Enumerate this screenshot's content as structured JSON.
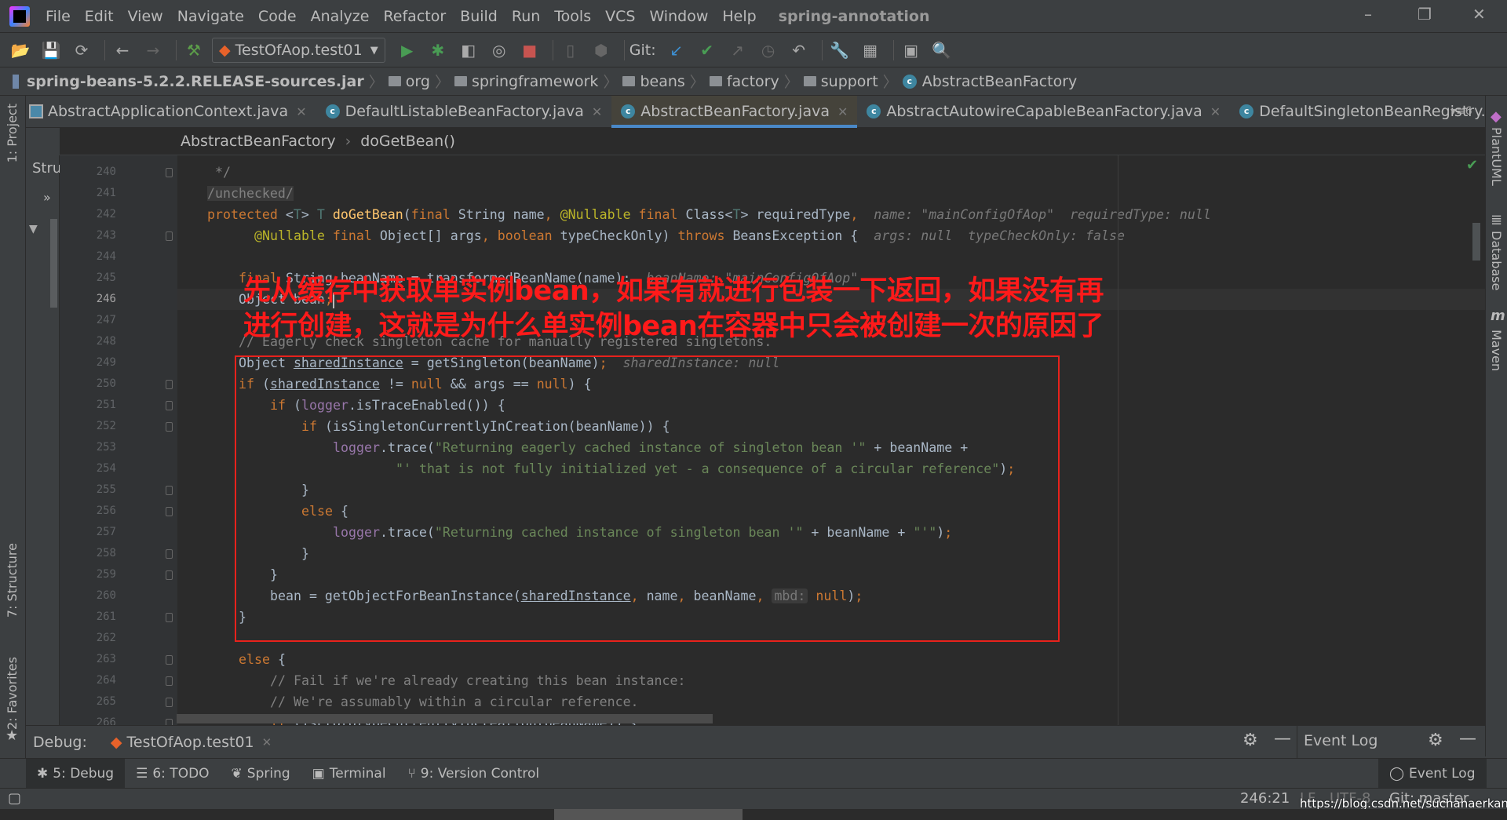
{
  "menubar": {
    "items": [
      "File",
      "Edit",
      "View",
      "Navigate",
      "Code",
      "Analyze",
      "Refactor",
      "Build",
      "Run",
      "Tools",
      "VCS",
      "Window",
      "Help"
    ],
    "project_title": "spring-annotation",
    "window_controls": [
      "–",
      "❐",
      "✕"
    ]
  },
  "toolbar": {
    "run_config": "TestOfAop.test01",
    "git_label": "Git:"
  },
  "navbar": {
    "jar": "spring-beans-5.2.2.RELEASE-sources.jar",
    "folders": [
      "org",
      "springframework",
      "beans",
      "factory",
      "support"
    ],
    "class": "AbstractBeanFactory"
  },
  "tabs": [
    {
      "label": "AbstractApplicationContext.java",
      "active": false
    },
    {
      "label": "DefaultListableBeanFactory.java",
      "active": false
    },
    {
      "label": "AbstractBeanFactory.java",
      "active": true
    },
    {
      "label": "AbstractAutowireCapableBeanFactory.java",
      "active": false
    },
    {
      "label": "DefaultSingletonBeanRegistry.java",
      "active": false
    }
  ],
  "tabs_overflow": "6",
  "editor_breadcrumb": {
    "class": "AbstractBeanFactory",
    "method": "doGetBean()"
  },
  "left_strip": {
    "project": "1: Project",
    "structure": "7: Structure",
    "favorites": "2: Favorites"
  },
  "structure_panel": {
    "label": "Stru",
    "expand": "»"
  },
  "right_strip": [
    "PlantUML",
    "Database",
    "Maven"
  ],
  "current_line": 246,
  "code": [
    {
      "n": 240,
      "i": 1,
      "t": [
        [
          "cm",
          "*/"
        ]
      ]
    },
    {
      "n": 241,
      "i": 0,
      "t": [
        [
          "cm fol",
          "/unchecked/"
        ]
      ]
    },
    {
      "n": 242,
      "i": 0,
      "t": [
        [
          "kw",
          "protected "
        ],
        [
          "",
          "<"
        ],
        [
          "tp",
          "T"
        ],
        [
          "",
          "> "
        ],
        [
          "tp",
          "T "
        ],
        [
          "fn",
          "doGetBean"
        ],
        [
          "",
          "("
        ],
        [
          "kw",
          "final "
        ],
        [
          "",
          "String name"
        ],
        [
          "kw",
          ", "
        ],
        [
          "ann",
          "@Nullable "
        ],
        [
          "kw",
          "final "
        ],
        [
          "",
          "Class<"
        ],
        [
          "tp",
          "T"
        ],
        [
          "",
          "> requiredType"
        ],
        [
          "kw",
          ","
        ],
        [
          "hint",
          "  name: \"mainConfigOfAop\"  requiredType: null"
        ]
      ]
    },
    {
      "n": 243,
      "i": 6,
      "t": [
        [
          "ann",
          "@Nullable "
        ],
        [
          "kw",
          "final "
        ],
        [
          "",
          "Object[] args"
        ],
        [
          "kw",
          ", boolean "
        ],
        [
          "",
          "typeCheckOnly) "
        ],
        [
          "kw",
          "throws "
        ],
        [
          "",
          "BeansException {"
        ],
        [
          "hint",
          "  args: null  typeCheckOnly: false"
        ]
      ]
    },
    {
      "n": 244,
      "i": 0,
      "t": []
    },
    {
      "n": 245,
      "i": 4,
      "t": [
        [
          "kw",
          "final "
        ],
        [
          "",
          "String beanName = transformedBeanName(name);"
        ],
        [
          "hint",
          "  beanName: \"mainConfigOfAop\""
        ]
      ]
    },
    {
      "n": 246,
      "i": 4,
      "t": [
        [
          "",
          "Object bean"
        ],
        [
          "kw",
          ";"
        ]
      ]
    },
    {
      "n": 247,
      "i": 0,
      "t": []
    },
    {
      "n": 248,
      "i": 4,
      "t": [
        [
          "cm",
          "// Eagerly check singleton cache for manually registered singletons."
        ]
      ]
    },
    {
      "n": 249,
      "i": 4,
      "t": [
        [
          "",
          "Object "
        ],
        [
          "ul",
          "sharedInstance"
        ],
        [
          "",
          " = getSingleton(beanName)"
        ],
        [
          "kw",
          ";"
        ],
        [
          "hint",
          "  sharedInstance: null"
        ]
      ]
    },
    {
      "n": 250,
      "i": 4,
      "t": [
        [
          "kw",
          "if "
        ],
        [
          "",
          "("
        ],
        [
          "ul",
          "sharedInstance"
        ],
        [
          "",
          " != "
        ],
        [
          "kw",
          "null "
        ],
        [
          "",
          "&& args == "
        ],
        [
          "kw",
          "null"
        ],
        [
          "",
          ") {"
        ]
      ]
    },
    {
      "n": 251,
      "i": 8,
      "t": [
        [
          "kw",
          "if "
        ],
        [
          "",
          "("
        ],
        [
          "fld",
          "logger"
        ],
        [
          "",
          ".isTraceEnabled()) {"
        ]
      ]
    },
    {
      "n": 252,
      "i": 12,
      "t": [
        [
          "kw",
          "if "
        ],
        [
          "",
          "(isSingletonCurrentlyInCreation(beanName)) {"
        ]
      ]
    },
    {
      "n": 253,
      "i": 16,
      "t": [
        [
          "fld",
          "logger"
        ],
        [
          "",
          ".trace("
        ],
        [
          "str",
          "\"Returning eagerly cached instance of singleton bean '\""
        ],
        [
          "",
          " + beanName +"
        ]
      ]
    },
    {
      "n": 254,
      "i": 24,
      "t": [
        [
          "str",
          "\"' that is not fully initialized yet - a consequence of a circular reference\""
        ],
        [
          "",
          ")"
        ],
        [
          "kw",
          ";"
        ]
      ]
    },
    {
      "n": 255,
      "i": 12,
      "t": [
        [
          "",
          "}"
        ]
      ]
    },
    {
      "n": 256,
      "i": 12,
      "t": [
        [
          "kw",
          "else "
        ],
        [
          "",
          "{"
        ]
      ]
    },
    {
      "n": 257,
      "i": 16,
      "t": [
        [
          "fld",
          "logger"
        ],
        [
          "",
          ".trace("
        ],
        [
          "str",
          "\"Returning cached instance of singleton bean '\""
        ],
        [
          "",
          " + beanName + "
        ],
        [
          "str",
          "\"'\""
        ],
        [
          "",
          ")"
        ],
        [
          "kw",
          ";"
        ]
      ]
    },
    {
      "n": 258,
      "i": 12,
      "t": [
        [
          "",
          "}"
        ]
      ]
    },
    {
      "n": 259,
      "i": 8,
      "t": [
        [
          "",
          "}"
        ]
      ]
    },
    {
      "n": 260,
      "i": 8,
      "t": [
        [
          "",
          "bean = getObjectForBeanInstance("
        ],
        [
          "ul",
          "sharedInstance"
        ],
        [
          "kw",
          ", "
        ],
        [
          "",
          "name"
        ],
        [
          "kw",
          ", "
        ],
        [
          "",
          "beanName"
        ],
        [
          "kw",
          ", "
        ],
        [
          "pill",
          "mbd:"
        ],
        [
          "kw",
          " null"
        ],
        [
          "",
          ")"
        ],
        [
          "kw",
          ";"
        ]
      ]
    },
    {
      "n": 261,
      "i": 4,
      "t": [
        [
          "",
          "}"
        ]
      ]
    },
    {
      "n": 262,
      "i": 0,
      "t": []
    },
    {
      "n": 263,
      "i": 4,
      "t": [
        [
          "kw",
          "else "
        ],
        [
          "",
          "{"
        ]
      ]
    },
    {
      "n": 264,
      "i": 8,
      "t": [
        [
          "cm",
          "// Fail if we're already creating this bean instance:"
        ]
      ]
    },
    {
      "n": 265,
      "i": 8,
      "t": [
        [
          "cm",
          "// We're assumably within a circular reference."
        ]
      ]
    },
    {
      "n": 266,
      "i": 8,
      "t": [
        [
          "kw",
          "if "
        ],
        [
          "",
          "(isPrototypeCurrentlyInCreation(beanName)) {"
        ]
      ]
    }
  ],
  "annotation": {
    "line1": "先从缓存中获取单实例bean，如果有就进行包装一下返回，如果没有再",
    "line2": "进行创建，这就是为什么单实例bean在容器中只会被创建一次的原因了"
  },
  "debug_bar": {
    "label": "Debug:",
    "session": "TestOfAop.test01",
    "event_log": "Event Log"
  },
  "tool_windows": [
    {
      "label": "5: Debug",
      "icon": "bug-icon",
      "active": true
    },
    {
      "label": "6: TODO",
      "icon": "list-icon",
      "active": false
    },
    {
      "label": "Spring",
      "icon": "leaf-icon",
      "active": false
    },
    {
      "label": "Terminal",
      "icon": "terminal-icon",
      "active": false
    },
    {
      "label": "9: Version Control",
      "icon": "branch-icon",
      "active": false
    }
  ],
  "event_log_button": "Event Log",
  "status": {
    "position": "246:21",
    "line_sep": "LF",
    "encoding": "UTF-8",
    "git": "Git: master"
  },
  "watermark": "https://blog.csdn.net/suchahaerkang",
  "colors": {
    "keyword": "#cc7832",
    "string": "#6a8759",
    "comment": "#808080",
    "annotation": "#bbb529",
    "highlight_box": "#e8221c",
    "active_tab_underline": "#4a88c7"
  }
}
